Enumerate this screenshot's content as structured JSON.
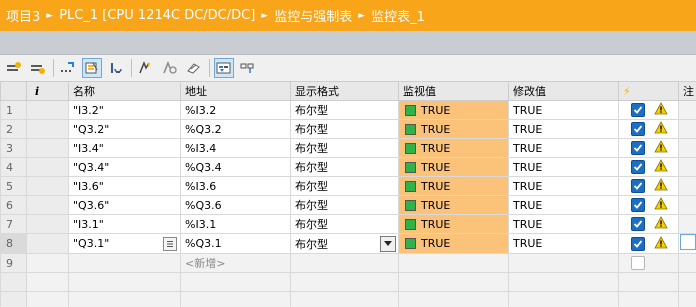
{
  "breadcrumb": [
    "项目3",
    "PLC_1 [CPU 1214C DC/DC/DC]",
    "监控与强制表",
    "监控表_1"
  ],
  "breadcrumb_separator": "►",
  "toolbar_icons": [
    "insert-row-icon",
    "add-row-icon",
    "refresh-icon",
    "monitor-all-icon",
    "monitor-once-icon",
    "modify-now-icon",
    "modify-trigger-icon",
    "force-icon",
    "show-modify-columns-icon",
    "show-extended-columns-icon"
  ],
  "columns": {
    "index": "i",
    "name": "名称",
    "address": "地址",
    "format": "显示格式",
    "monitor": "监视值",
    "modify": "修改值",
    "modify_flag": "⚡",
    "comment": "注"
  },
  "rows": [
    {
      "num": "1",
      "name": "\"I3.2\"",
      "address": "%I3.2",
      "format": "布尔型",
      "monitor": "TRUE",
      "modify": "TRUE"
    },
    {
      "num": "2",
      "name": "\"Q3.2\"",
      "address": "%Q3.2",
      "format": "布尔型",
      "monitor": "TRUE",
      "modify": "TRUE"
    },
    {
      "num": "3",
      "name": "\"I3.4\"",
      "address": "%I3.4",
      "format": "布尔型",
      "monitor": "TRUE",
      "modify": "TRUE"
    },
    {
      "num": "4",
      "name": "\"Q3.4\"",
      "address": "%Q3.4",
      "format": "布尔型",
      "monitor": "TRUE",
      "modify": "TRUE"
    },
    {
      "num": "5",
      "name": "\"I3.6\"",
      "address": "%I3.6",
      "format": "布尔型",
      "monitor": "TRUE",
      "modify": "TRUE"
    },
    {
      "num": "6",
      "name": "\"Q3.6\"",
      "address": "%Q3.6",
      "format": "布尔型",
      "monitor": "TRUE",
      "modify": "TRUE"
    },
    {
      "num": "7",
      "name": "\"I3.1\"",
      "address": "%I3.1",
      "format": "布尔型",
      "monitor": "TRUE",
      "modify": "TRUE"
    },
    {
      "num": "8",
      "name": "\"Q3.1\"",
      "address": "%Q3.1",
      "format": "布尔型",
      "monitor": "TRUE",
      "modify": "TRUE"
    }
  ],
  "new_row": {
    "num": "9",
    "address_placeholder": "<新增>"
  },
  "colors": {
    "title_bar": "#f9a51a",
    "monitor_cell": "#fbc37a",
    "status_true": "#2db34a",
    "checkbox": "#1d6fc1",
    "warning": "#f5d000"
  }
}
